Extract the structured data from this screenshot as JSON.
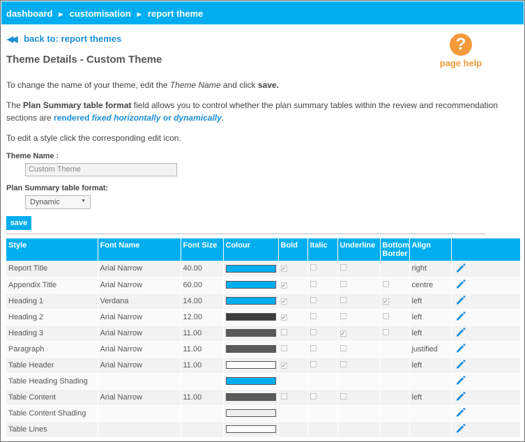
{
  "breadcrumb": {
    "item1": "dashboard",
    "item2": "customisation",
    "item3": "report theme",
    "separator": "►"
  },
  "back_link": {
    "arrow": "◀◀",
    "text": "back to: report themes"
  },
  "page_title": "Theme Details - Custom Theme",
  "page_help": {
    "icon": "?",
    "label": "page help"
  },
  "intro": {
    "l1_a": "To change the name of your theme, edit the ",
    "l1_b": "Theme Name",
    "l1_c": " and click ",
    "l1_d": "save.",
    "l2_a": "The ",
    "l2_b": "Plan Summary table format",
    "l2_c": " field allows you to control whether the plan summary tables within the review and recommendation",
    "l3_a": "sections are ",
    "l3_b": "rendered ",
    "l3_c": "fixed horizontally",
    "l3_d": " or ",
    "l3_e": "dynamically",
    "l3_f": ".",
    "l4": "To edit a style click the corresponding edit icon."
  },
  "form": {
    "theme_name_label": "Theme Name :",
    "theme_name_value": "Custom Theme",
    "format_label": "Plan Summary table format:",
    "format_value": "Dynamic",
    "save_label": "save"
  },
  "table": {
    "headers": {
      "style": "Style",
      "font": "Font Name",
      "size": "Font Size",
      "colour": "Colour",
      "bold": "Bold",
      "italic": "Italic",
      "underline": "Underline",
      "border1": "Bottom",
      "border2": "Border",
      "align": "Align"
    },
    "rows": [
      {
        "style": "Report Title",
        "font": "Arial Narrow",
        "size": "40.00",
        "colour": "#00aeef",
        "bold": true,
        "italic": false,
        "underline": false,
        "border": null,
        "align": "right"
      },
      {
        "style": "Appendix Title",
        "font": "Arial Narrow",
        "size": "60.00",
        "colour": "#00aeef",
        "bold": true,
        "italic": false,
        "underline": false,
        "border": false,
        "align": "centre"
      },
      {
        "style": "Heading 1",
        "font": "Verdana",
        "size": "14.00",
        "colour": "#00aeef",
        "bold": true,
        "italic": false,
        "underline": false,
        "border": true,
        "align": "left"
      },
      {
        "style": "Heading 2",
        "font": "Arial Narrow",
        "size": "12.00",
        "colour": "#3c3c3c",
        "bold": true,
        "italic": false,
        "underline": false,
        "border": false,
        "align": "left"
      },
      {
        "style": "Heading 3",
        "font": "Arial Narrow",
        "size": "11.00",
        "colour": "#5a5a5a",
        "bold": false,
        "italic": false,
        "underline": true,
        "border": false,
        "align": "left"
      },
      {
        "style": "Paragraph",
        "font": "Arial Narrow",
        "size": "11.00",
        "colour": "#5a5a5a",
        "bold": false,
        "italic": false,
        "underline": false,
        "border": null,
        "align": "justified"
      },
      {
        "style": "Table Header",
        "font": "Arial Narrow",
        "size": "11.00",
        "colour": "#ffffff",
        "bold": true,
        "italic": false,
        "underline": false,
        "border": null,
        "align": "left"
      },
      {
        "style": "Table Heading Shading",
        "font": "",
        "size": "",
        "colour": "#00aeef",
        "bold": null,
        "italic": null,
        "underline": null,
        "border": null,
        "align": ""
      },
      {
        "style": "Table Content",
        "font": "Arial Narrow",
        "size": "11.00",
        "colour": "#5a5a5a",
        "bold": false,
        "italic": false,
        "underline": false,
        "border": null,
        "align": "left"
      },
      {
        "style": "Table Content Shading",
        "font": "",
        "size": "",
        "colour": "#f0f0f0",
        "bold": null,
        "italic": null,
        "underline": null,
        "border": null,
        "align": ""
      },
      {
        "style": "Table Lines",
        "font": "",
        "size": "",
        "colour": "#ffffff",
        "bold": null,
        "italic": null,
        "underline": null,
        "border": null,
        "align": ""
      }
    ]
  },
  "colors": {
    "accent": "#00aeef",
    "help": "#f59a3b",
    "link": "#1c8fd6"
  }
}
